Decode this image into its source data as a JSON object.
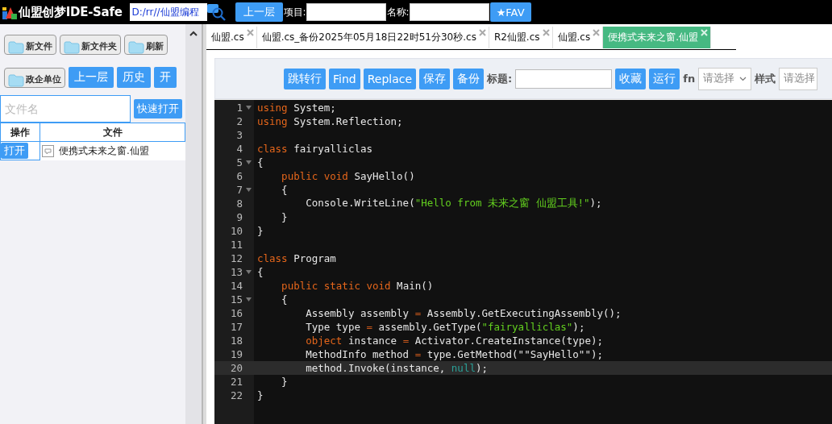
{
  "header": {
    "title": "仙盟创梦IDE-Safe",
    "path": "D:/rr//仙盟编程",
    "up_button": "上一层",
    "project_label": "项目:",
    "name_label": "名称:",
    "fav_button": "★FAV"
  },
  "sidebar": {
    "button_rows": [
      [
        {
          "kind": "folder",
          "label": "新文件"
        },
        {
          "kind": "folder",
          "label": "新文件夹"
        },
        {
          "kind": "folder",
          "label": "刷新"
        }
      ],
      [
        {
          "kind": "folder",
          "label": "政企单位"
        },
        {
          "kind": "primary",
          "label": "上一层"
        },
        {
          "kind": "primary",
          "label": "历史"
        },
        {
          "kind": "primary",
          "label": "开"
        }
      ]
    ],
    "file_search": {
      "placeholder": "文件名",
      "button": "快速打开"
    },
    "table": {
      "columns": [
        "操作",
        "文件"
      ],
      "rows": [
        {
          "action": "打开",
          "file": "便携式未来之窗.仙盟"
        }
      ]
    }
  },
  "tabs": [
    {
      "label": "仙盟.cs",
      "selected": false
    },
    {
      "label": "仙盟.cs_备份2025年05月18日22时51分30秒.cs",
      "selected": false
    },
    {
      "label": "R2仙盟.cs",
      "selected": false
    },
    {
      "label": "仙盟.cs",
      "selected": false
    },
    {
      "label": "便携式未来之窗.仙盟",
      "selected": true
    }
  ],
  "toolbar": {
    "items": [
      {
        "kind": "button",
        "text": "跳转行"
      },
      {
        "kind": "button",
        "text": "Find"
      },
      {
        "kind": "button",
        "text": "Replace"
      },
      {
        "kind": "button",
        "text": "保存"
      },
      {
        "kind": "button",
        "text": "备份"
      },
      {
        "kind": "label",
        "text": "标题:"
      },
      {
        "kind": "input"
      },
      {
        "kind": "button",
        "text": "收藏"
      },
      {
        "kind": "button",
        "text": "运行"
      },
      {
        "kind": "label",
        "text": "fn"
      },
      {
        "kind": "select",
        "text": "请选择"
      },
      {
        "kind": "label",
        "text": "样式"
      },
      {
        "kind": "select",
        "text": "请选择"
      }
    ]
  },
  "editor": {
    "lines": [
      {
        "number": "1",
        "fold": true,
        "active": false,
        "tokens": [
          {
            "kind": "kw",
            "text": "using"
          },
          {
            "kind": "id",
            "text": " System;"
          }
        ]
      },
      {
        "number": "2",
        "fold": false,
        "active": false,
        "tokens": [
          {
            "kind": "kw",
            "text": "using"
          },
          {
            "kind": "id",
            "text": " System.Reflection;"
          }
        ]
      },
      {
        "number": "3",
        "fold": false,
        "active": false
      },
      {
        "number": "4",
        "fold": false,
        "active": false,
        "tokens": [
          {
            "kind": "kw",
            "text": "class"
          },
          {
            "kind": "id",
            "text": " fairyalliclas"
          }
        ]
      },
      {
        "number": "5",
        "fold": true,
        "active": false,
        "tokens": [
          {
            "kind": "id",
            "text": "{"
          }
        ]
      },
      {
        "number": "6",
        "fold": false,
        "active": false,
        "tokens": [
          {
            "kind": "kw",
            "text": "    public void"
          },
          {
            "kind": "id",
            "text": " SayHello()"
          }
        ]
      },
      {
        "number": "7",
        "fold": true,
        "active": false,
        "tokens": [
          {
            "kind": "id",
            "text": "    {"
          }
        ]
      },
      {
        "number": "8",
        "fold": false,
        "active": false,
        "tokens": [
          {
            "kind": "id",
            "text": "        Console.WriteLine("
          },
          {
            "kind": "str",
            "text": "\"Hello from 未来之窗 仙盟工具!\""
          },
          {
            "kind": "id",
            "text": ");"
          }
        ]
      },
      {
        "number": "9",
        "fold": false,
        "active": false,
        "tokens": [
          {
            "kind": "id",
            "text": "    }"
          }
        ]
      },
      {
        "number": "10",
        "fold": false,
        "active": false,
        "tokens": [
          {
            "kind": "id",
            "text": "}"
          }
        ]
      },
      {
        "number": "11",
        "fold": false,
        "active": false
      },
      {
        "number": "12",
        "fold": false,
        "active": false,
        "tokens": [
          {
            "kind": "kw",
            "text": "class"
          },
          {
            "kind": "id",
            "text": " Program"
          }
        ]
      },
      {
        "number": "13",
        "fold": true,
        "active": false,
        "tokens": [
          {
            "kind": "id",
            "text": "{"
          }
        ]
      },
      {
        "number": "14",
        "fold": false,
        "active": false,
        "tokens": [
          {
            "kind": "kw",
            "text": "    public static void"
          },
          {
            "kind": "id",
            "text": " Main()"
          }
        ]
      },
      {
        "number": "15",
        "fold": true,
        "active": false,
        "tokens": [
          {
            "kind": "id",
            "text": "    {"
          }
        ]
      },
      {
        "number": "16",
        "fold": false,
        "active": false,
        "tokens": [
          {
            "kind": "id",
            "text": "        Assembly assembly "
          },
          {
            "kind": "op",
            "text": "="
          },
          {
            "kind": "id",
            "text": " Assembly.GetExecutingAssembly();"
          }
        ]
      },
      {
        "number": "17",
        "fold": false,
        "active": false,
        "tokens": [
          {
            "kind": "id",
            "text": "        Type type "
          },
          {
            "kind": "op",
            "text": "="
          },
          {
            "kind": "id",
            "text": " assembly.GetType("
          },
          {
            "kind": "str",
            "text": "\"fairyalliclas\""
          },
          {
            "kind": "id",
            "text": ");"
          }
        ]
      },
      {
        "number": "18",
        "fold": false,
        "active": false,
        "tokens": [
          {
            "kind": "kw",
            "text": "        object"
          },
          {
            "kind": "id",
            "text": " instance "
          },
          {
            "kind": "op",
            "text": "="
          },
          {
            "kind": "id",
            "text": " Activator.CreateInstance(type);"
          }
        ]
      },
      {
        "number": "19",
        "fold": false,
        "active": false,
        "tokens": [
          {
            "kind": "id",
            "text": "        MethodInfo method "
          },
          {
            "kind": "op",
            "text": "="
          },
          {
            "kind": "id",
            "text": " type.GetMethod(\"\"SayHello\"\");"
          }
        ]
      },
      {
        "number": "20",
        "fold": false,
        "active": true,
        "tokens": [
          {
            "kind": "id",
            "text": "        method.Invoke(instance, "
          },
          {
            "kind": "lit",
            "text": "null"
          },
          {
            "kind": "id",
            "text": ");"
          }
        ]
      },
      {
        "number": "21",
        "fold": false,
        "active": false,
        "tokens": [
          {
            "kind": "id",
            "text": "    }"
          }
        ]
      },
      {
        "number": "22",
        "fold": false,
        "active": false,
        "tokens": [
          {
            "kind": "id",
            "text": "}"
          }
        ]
      }
    ]
  }
}
